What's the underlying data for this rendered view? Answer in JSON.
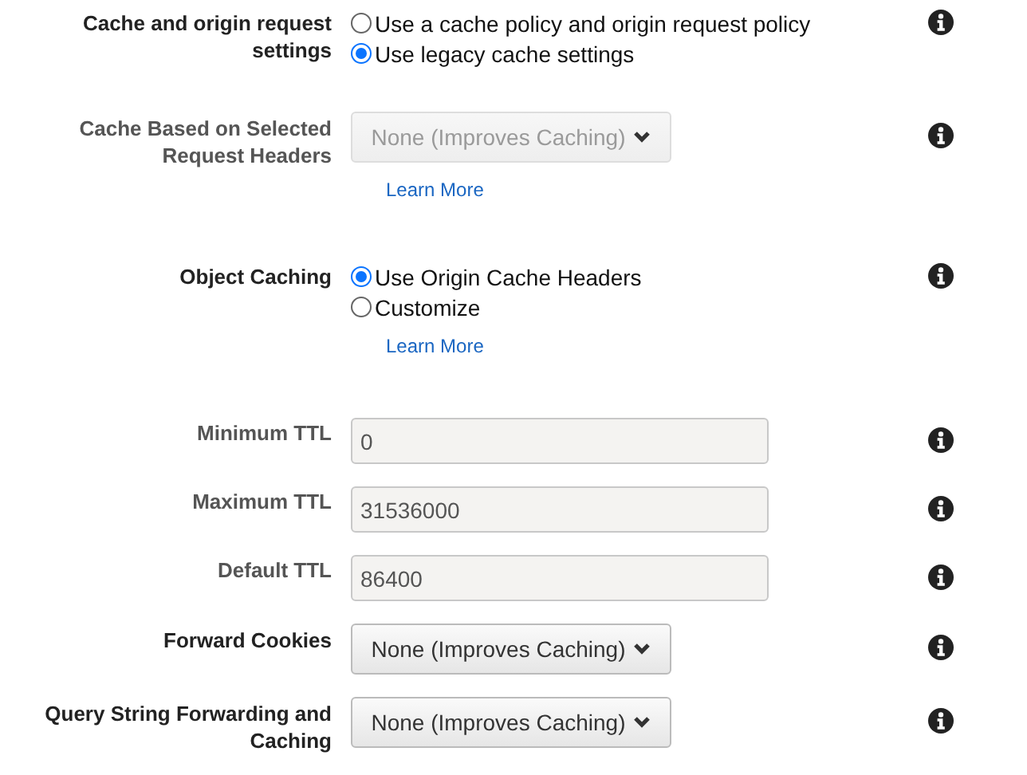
{
  "settings": [
    {
      "kind": "radio",
      "label": "Cache and origin request settings",
      "options": [
        {
          "label": "Use a cache policy and origin request policy",
          "selected": false
        },
        {
          "label": "Use legacy cache settings",
          "selected": true
        }
      ]
    },
    {
      "kind": "select",
      "label": "Cache Based on Selected Request Headers",
      "disabled": true,
      "value": "None (Improves Caching)",
      "link": "Learn More"
    },
    {
      "kind": "radio",
      "label": "Object Caching",
      "options": [
        {
          "label": "Use Origin Cache Headers",
          "selected": true
        },
        {
          "label": "Customize",
          "selected": false
        }
      ],
      "link": "Learn More"
    },
    {
      "kind": "input",
      "label": "Minimum TTL",
      "disabled": true,
      "value": "0"
    },
    {
      "kind": "input",
      "label": "Maximum TTL",
      "disabled": true,
      "value": "31536000"
    },
    {
      "kind": "input",
      "label": "Default TTL",
      "disabled": true,
      "value": "86400"
    },
    {
      "kind": "select",
      "label": "Forward Cookies",
      "disabled": false,
      "value": "None (Improves Caching)"
    },
    {
      "kind": "select",
      "label": "Query String Forwarding and Caching",
      "disabled": false,
      "value": "None (Improves Caching)"
    }
  ]
}
